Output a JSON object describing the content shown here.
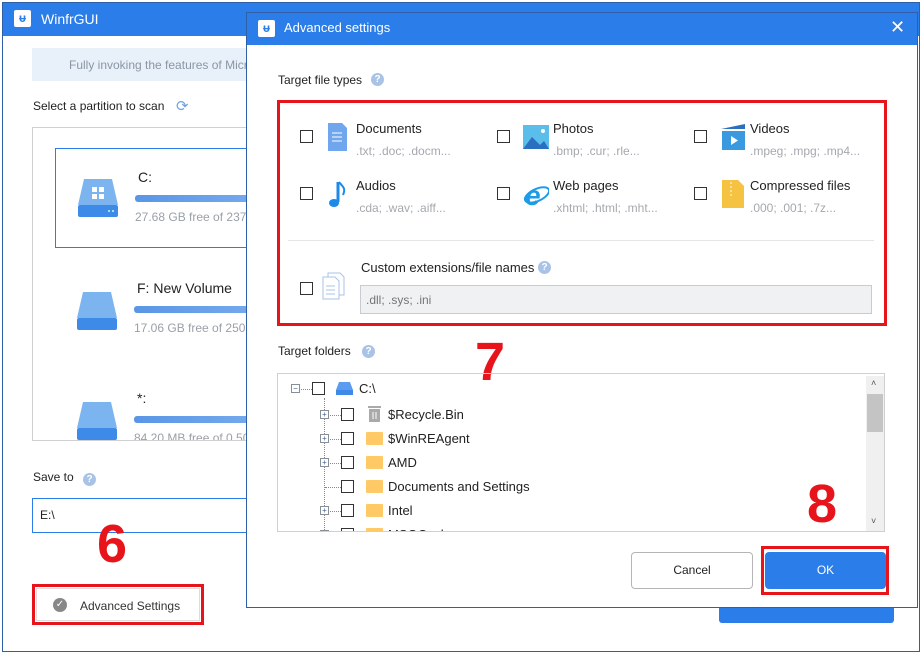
{
  "main": {
    "title": "WinfrGUI",
    "banner": "Fully invoking the features of Micr",
    "partition_heading": "Select a partition to scan",
    "partitions": [
      {
        "name": "C:",
        "free": "27.68 GB free of 237",
        "selected": true
      },
      {
        "name": "F: New Volume",
        "free": "17.06 GB free of 250"
      },
      {
        "name": "*:",
        "free": "84.20 MB free of 0.50"
      }
    ],
    "save_to_label": "Save to",
    "save_to_value": "E:\\",
    "advanced_settings_label": "Advanced Settings"
  },
  "dialog": {
    "title": "Advanced settings",
    "file_types_label": "Target file types",
    "file_types": [
      {
        "name": "Documents",
        "ext": ".txt; .doc; .docm...",
        "icon": "document-icon"
      },
      {
        "name": "Photos",
        "ext": ".bmp; .cur; .rle...",
        "icon": "photo-icon"
      },
      {
        "name": "Videos",
        "ext": ".mpeg; .mpg; .mp4...",
        "icon": "video-icon"
      },
      {
        "name": "Audios",
        "ext": ".cda; .wav; .aiff...",
        "icon": "music-note-icon"
      },
      {
        "name": "Web pages",
        "ext": ".xhtml; .html; .mht...",
        "icon": "web-page-icon"
      },
      {
        "name": "Compressed files",
        "ext": ".000; .001; .7z...",
        "icon": "zip-icon"
      }
    ],
    "custom_label": "Custom extensions/file names",
    "custom_placeholder": ".dll; .sys; .ini",
    "folders_label": "Target folders",
    "tree_root": "C:\\",
    "tree_children": [
      {
        "name": "$Recycle.Bin",
        "expandable": true,
        "icon": "recycle-bin-icon"
      },
      {
        "name": "$WinREAgent",
        "expandable": true,
        "icon": "folder-icon"
      },
      {
        "name": "AMD",
        "expandable": true,
        "icon": "folder-icon"
      },
      {
        "name": "Documents and Settings",
        "expandable": false,
        "icon": "folder-icon"
      },
      {
        "name": "Intel",
        "expandable": true,
        "icon": "folder-icon"
      },
      {
        "name": "MSOCache",
        "expandable": true,
        "icon": "folder-icon"
      }
    ],
    "cancel_label": "Cancel",
    "ok_label": "OK"
  },
  "annotations": {
    "step6": "6",
    "step7": "7",
    "step8": "8"
  },
  "colors": {
    "accent": "#2b7de9",
    "highlight": "#e8141c"
  }
}
